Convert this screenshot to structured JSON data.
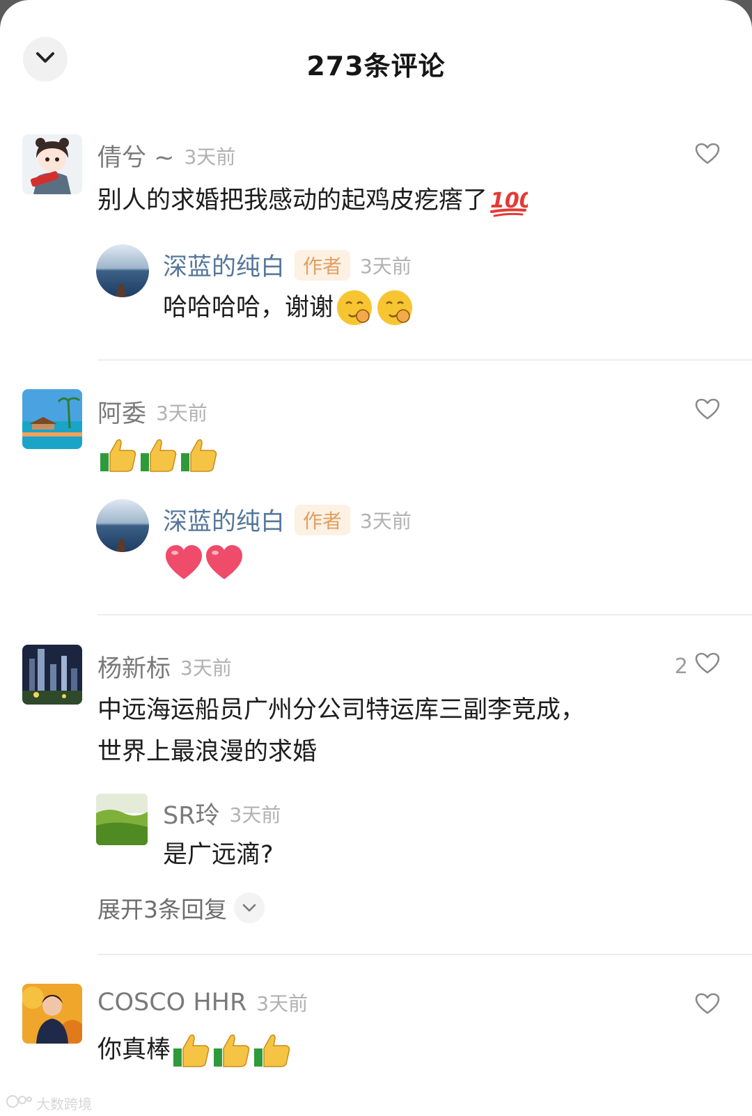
{
  "header": {
    "title": "273条评论",
    "collapse_icon": "chevron-down-icon"
  },
  "colors": {
    "author_name": "#56779b",
    "badge_text": "#e0a060",
    "badge_bg": "#fdf1e4",
    "heart_red": "#ef4b6a"
  },
  "comments": [
    {
      "name": "倩兮 ~",
      "time": "3天前",
      "text": "别人的求婚把我感动的起鸡皮疙瘩了",
      "emojis": [
        "hundred-points-emoji"
      ],
      "reply": {
        "name": "深蓝的纯白",
        "badge": "作者",
        "time": "3天前",
        "text": "哈哈哈哈，谢谢",
        "emojis": [
          "shy-face-emoji",
          "shy-face-emoji"
        ]
      }
    },
    {
      "name": "阿委",
      "time": "3天前",
      "text": "",
      "emojis": [
        "thumbs-up-emoji",
        "thumbs-up-emoji",
        "thumbs-up-emoji"
      ],
      "reply": {
        "name": "深蓝的纯白",
        "badge": "作者",
        "time": "3天前",
        "text": "",
        "emojis": [
          "red-heart-emoji",
          "red-heart-emoji"
        ]
      }
    },
    {
      "name": "杨新标",
      "time": "3天前",
      "like_count": "2",
      "text_line1": "中远海运船员广州分公司特运库三副李竞成，",
      "text_line2": "世界上最浪漫的求婚",
      "reply": {
        "name": "SR玲",
        "time": "3天前",
        "text": "是广远滴?"
      },
      "expand_label": "展开3条回复"
    },
    {
      "name": "COSCO HHR",
      "time": "3天前",
      "text": "你真棒",
      "emojis": [
        "thumbs-up-emoji",
        "thumbs-up-emoji",
        "thumbs-up-emoji"
      ]
    }
  ],
  "watermark": "大数跨境"
}
